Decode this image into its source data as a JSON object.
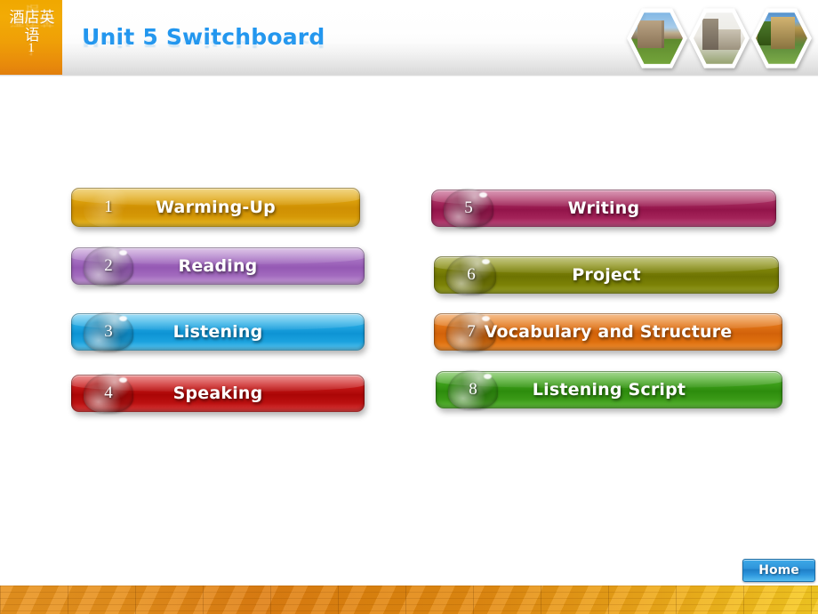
{
  "header": {
    "logo_cn": "酒店英语",
    "logo_number": "1",
    "title": "Unit 5 Switchboard",
    "thumbnails": [
      {
        "name": "hex-photo-campus-1"
      },
      {
        "name": "hex-photo-campus-2"
      },
      {
        "name": "hex-photo-campus-3"
      }
    ]
  },
  "menu": {
    "left": [
      {
        "number": "1",
        "label": "Warming-Up",
        "color": "#dca00a",
        "style": "flat"
      },
      {
        "number": "2",
        "label": "Reading",
        "color": "#a46cc1",
        "style": "bubble"
      },
      {
        "number": "3",
        "label": "Listening",
        "color": "#22a5de",
        "style": "bubble"
      },
      {
        "number": "4",
        "label": "Speaking",
        "color": "#c11a1a",
        "style": "bubble"
      }
    ],
    "right": [
      {
        "number": "5",
        "label": "Writing",
        "color": "#a8326a",
        "style": "bubble"
      },
      {
        "number": "6",
        "label": "Project",
        "color": "#7c8209",
        "style": "bubble"
      },
      {
        "number": "7",
        "label": "Vocabulary and Structure",
        "color": "#e0700f",
        "style": "bubble"
      },
      {
        "number": "8",
        "label": "Listening Script",
        "color": "#3f9e22",
        "style": "bubble"
      }
    ]
  },
  "footer": {
    "home_label": "Home"
  }
}
